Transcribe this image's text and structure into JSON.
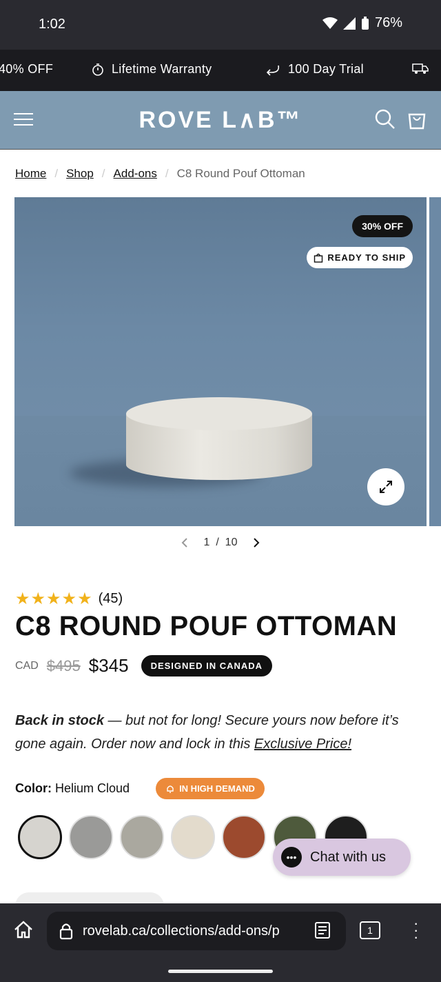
{
  "status": {
    "time": "1:02",
    "battery": "76%"
  },
  "promo": [
    {
      "label": "40% OFF"
    },
    {
      "icon": "stopwatch-icon",
      "label": "Lifetime Warranty"
    },
    {
      "icon": "return-arrow-icon",
      "label": "100 Day Trial"
    },
    {
      "icon": "truck-icon",
      "label": ""
    }
  ],
  "header": {
    "logo": "ROVE L∧B™",
    "cart_count": "0"
  },
  "breadcrumb": {
    "home": "Home",
    "shop": "Shop",
    "addons": "Add-ons",
    "current": "C8 Round Pouf Ottoman"
  },
  "gallery": {
    "sale_badge": "30% OFF",
    "ready_badge": "READY TO SHIP",
    "page": "1",
    "total": "10"
  },
  "product": {
    "rating_count": "(45)",
    "title": "C8 ROUND POUF OTTOMAN",
    "currency": "CAD",
    "old_price": "$495",
    "price": "$345",
    "designed_tag": "DESIGNED IN CANADA",
    "desc_bold": "Back in stock",
    "desc_text": " — but not for long! Secure yours now before it’s gone again. Order now and lock in this ",
    "desc_link": "Exclusive Price!",
    "color_label": "Color:",
    "color_value": "Helium Cloud",
    "demand_badge": "IN HIGH DEMAND",
    "swatches": [
      "#d6d4cf",
      "#9a9a98",
      "#aaa89f",
      "#e3dbcc",
      "#9c4a2e",
      "#4e5a3c",
      "#1e1e1e"
    ]
  },
  "chat": {
    "label": "Chat with us"
  },
  "browser": {
    "url": "rovelab.ca/collections/add-ons/p",
    "tabs": "1"
  }
}
